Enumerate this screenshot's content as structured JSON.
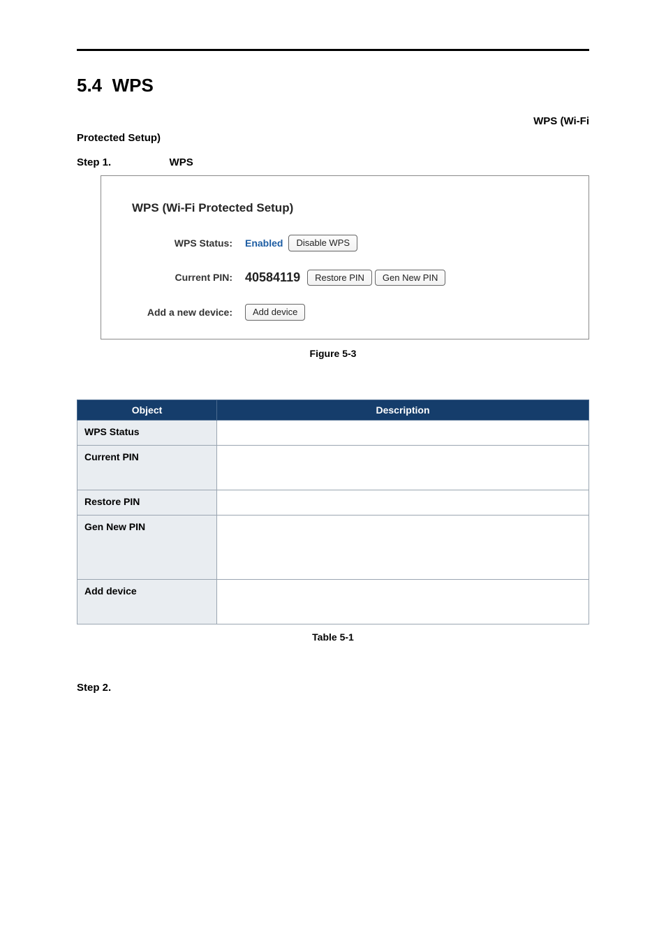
{
  "section": {
    "number": "5.4",
    "title": "WPS"
  },
  "intro": {
    "right_frag": "WPS (Wi-Fi",
    "cont": "Protected Setup)"
  },
  "step1": {
    "label": "Step 1.",
    "kw": "WPS"
  },
  "screenshot": {
    "title": "WPS (Wi-Fi Protected Setup)",
    "rows": {
      "status": {
        "label": "WPS Status:",
        "value": "Enabled",
        "btn_disable": "Disable WPS"
      },
      "pin": {
        "label": "Current PIN:",
        "value": "40584119",
        "btn_restore": "Restore PIN",
        "btn_gen": "Gen New PIN"
      },
      "add": {
        "label": "Add a new device:",
        "btn_add": "Add device"
      }
    }
  },
  "fig_caption": "Figure 5-3",
  "table": {
    "head_obj": "Object",
    "head_desc": "Description",
    "rows": [
      {
        "obj": "WPS Status",
        "h": "row-h-1"
      },
      {
        "obj": "Current PIN",
        "h": "row-h-2"
      },
      {
        "obj": "Restore PIN",
        "h": "row-h-1"
      },
      {
        "obj": "Gen New PIN",
        "h": "row-h-3"
      },
      {
        "obj": "Add device",
        "h": "row-h-2"
      }
    ]
  },
  "table_caption": "Table 5-1",
  "step2": {
    "label": "Step 2."
  }
}
